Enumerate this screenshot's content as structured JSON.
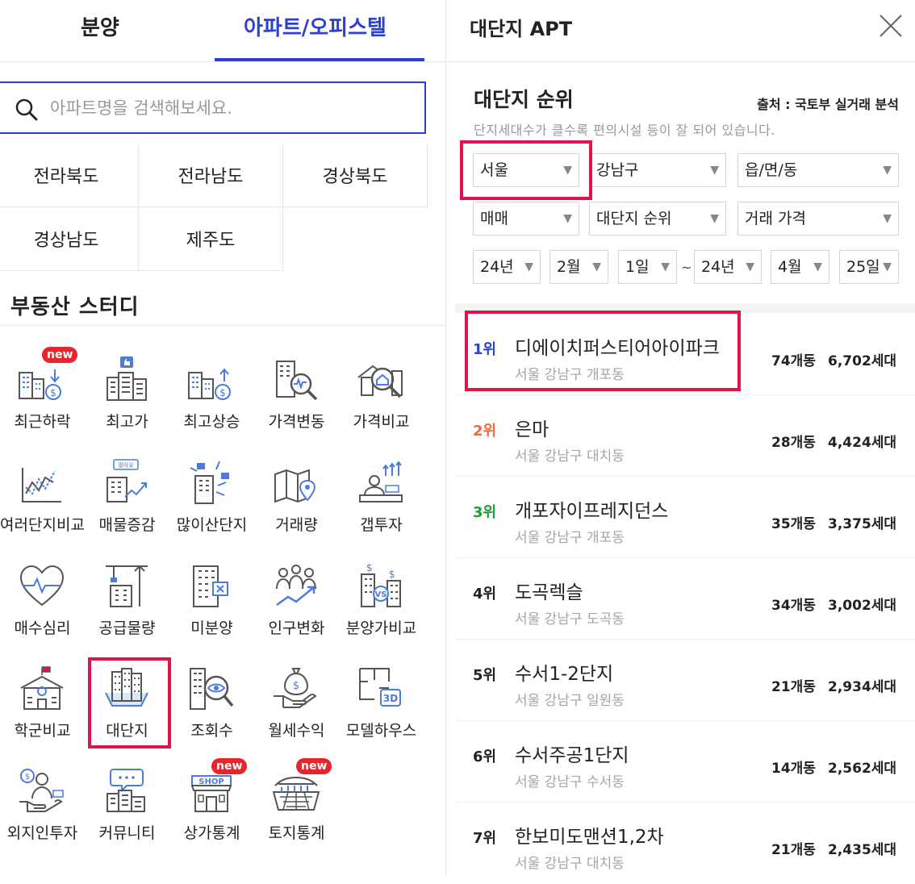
{
  "tabs": [
    {
      "label": "분양"
    },
    {
      "label": "아파트/오피스텔"
    }
  ],
  "search": {
    "placeholder": "아파트명을 검색해보세요."
  },
  "regions": [
    "전라북도",
    "전라남도",
    "경상북도",
    "경상남도",
    "제주도"
  ],
  "study": {
    "title": "부동산 스터디",
    "items": [
      {
        "label": "최근하락",
        "icon": "price-down-building-icon",
        "badge": "new"
      },
      {
        "label": "최고가",
        "icon": "thumbs-up-building-icon"
      },
      {
        "label": "최고상승",
        "icon": "price-up-building-icon"
      },
      {
        "label": "가격변동",
        "icon": "building-pulse-magnifier-icon"
      },
      {
        "label": "가격비교",
        "icon": "house-magnifier-icon"
      },
      {
        "label": "여러단지비교",
        "icon": "line-chart-icon"
      },
      {
        "label": "매물증감",
        "icon": "for-sale-chart-icon",
        "sign": "팔아요"
      },
      {
        "label": "많이산단지",
        "icon": "buy-hands-building-icon"
      },
      {
        "label": "거래량",
        "icon": "map-pin-icon"
      },
      {
        "label": "갭투자",
        "icon": "investor-desk-icon"
      },
      {
        "label": "매수심리",
        "icon": "heart-pulse-icon"
      },
      {
        "label": "공급물량",
        "icon": "crane-building-icon"
      },
      {
        "label": "미분양",
        "icon": "unsold-building-icon"
      },
      {
        "label": "인구변화",
        "icon": "people-growth-icon"
      },
      {
        "label": "분양가비교",
        "icon": "building-vs-icon",
        "vs": "VS"
      },
      {
        "label": "학군비교",
        "icon": "school-icon"
      },
      {
        "label": "대단지",
        "icon": "apartment-complex-icon"
      },
      {
        "label": "조회수",
        "icon": "building-eye-icon"
      },
      {
        "label": "월세수익",
        "icon": "money-bag-hand-icon"
      },
      {
        "label": "모델하우스",
        "icon": "floorplan-3d-icon",
        "tag": "3D"
      },
      {
        "label": "외지인투자",
        "icon": "investor-money-icon"
      },
      {
        "label": "커뮤니티",
        "icon": "chat-building-icon"
      },
      {
        "label": "상가통계",
        "icon": "shop-icon",
        "badge": "new",
        "sign": "SHOP"
      },
      {
        "label": "토지통계",
        "icon": "land-field-icon",
        "badge": "new"
      }
    ]
  },
  "panel": {
    "title": "대단지 APT",
    "ranking_title": "대단지 순위",
    "source": "출처 : 국토부 실거래 분석",
    "description": "단지세대수가 클수록 편의시설 등이 잘 되어 있습니다.",
    "filters": {
      "city": "서울",
      "district": "강남구",
      "town": "읍/면/동",
      "trade_type": "매매",
      "sort": "대단지 순위",
      "price": "거래 가격",
      "from_year": "24년",
      "from_month": "2월",
      "from_day": "1일",
      "to_year": "24년",
      "to_month": "4월",
      "to_day": "25일",
      "range_separator": "~"
    },
    "ranks": [
      {
        "rank": "1위",
        "name": "디에이치퍼스티어아이파크",
        "address": "서울 강남구 개포동",
        "dong": "74개동",
        "units": "6,702세대",
        "color": "#2b3fd6"
      },
      {
        "rank": "2위",
        "name": "은마",
        "address": "서울 강남구 대치동",
        "dong": "28개동",
        "units": "4,424세대",
        "color": "#f06a3a"
      },
      {
        "rank": "3위",
        "name": "개포자이프레지던스",
        "address": "서울 강남구 개포동",
        "dong": "35개동",
        "units": "3,375세대",
        "color": "#1aa02e"
      },
      {
        "rank": "4위",
        "name": "도곡렉슬",
        "address": "서울 강남구 도곡동",
        "dong": "34개동",
        "units": "3,002세대",
        "color": "#222222"
      },
      {
        "rank": "5위",
        "name": "수서1-2단지",
        "address": "서울 강남구 일원동",
        "dong": "21개동",
        "units": "2,934세대",
        "color": "#222222"
      },
      {
        "rank": "6위",
        "name": "수서주공1단지",
        "address": "서울 강남구 수서동",
        "dong": "14개동",
        "units": "2,562세대",
        "color": "#222222"
      },
      {
        "rank": "7위",
        "name": "한보미도맨션1,2차",
        "address": "서울 강남구 대치동",
        "dong": "21개동",
        "units": "2,435세대",
        "color": "#222222"
      }
    ]
  }
}
